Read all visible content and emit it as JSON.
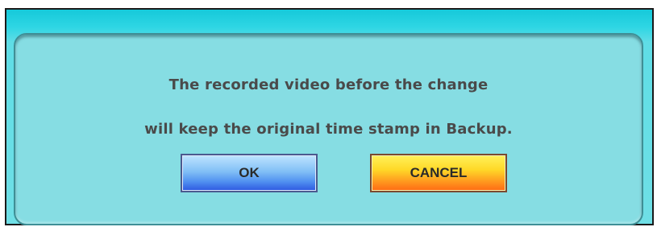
{
  "dialog": {
    "message_line1": "The recorded video before the change",
    "message_line2": "will keep the original time stamp in Backup.",
    "ok_label": "OK",
    "cancel_label": "CANCEL"
  },
  "colors": {
    "title_bar": "#16c9da",
    "panel_bg": "#86dde3",
    "ok_button": "#4f8ff0",
    "cancel_button": "#ffa020",
    "text": "#4a4a4a"
  }
}
